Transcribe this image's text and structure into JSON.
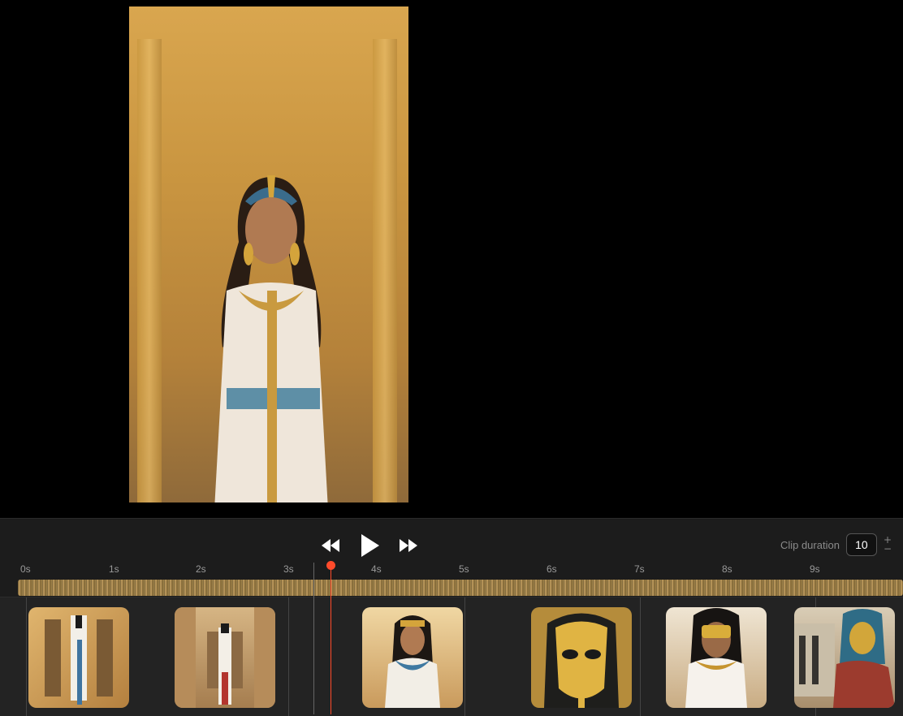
{
  "preview": {
    "image": "egyptian-woman-preview"
  },
  "transport": {
    "rewind_icon": "rewind-icon",
    "play_icon": "play-icon",
    "forward_icon": "fast-forward-icon"
  },
  "clip_duration": {
    "label": "Clip duration",
    "value": "10"
  },
  "ruler": {
    "ticks": [
      "0s",
      "1s",
      "2s",
      "3s",
      "4s",
      "5s",
      "6s",
      "7s",
      "8s",
      "9s"
    ]
  },
  "playhead": {
    "time_seconds": 3.5
  },
  "thumbnails": [
    {
      "name": "pharaoh-guards-clip"
    },
    {
      "name": "temple-queen-clip"
    },
    {
      "name": "cleopatra-portrait-clip"
    },
    {
      "name": "golden-mask-clip"
    },
    {
      "name": "golden-mask-woman-clip"
    },
    {
      "name": "masked-man-temple-clip"
    }
  ],
  "colors": {
    "playhead": "#ff4b2b",
    "panel": "#1c1c1c"
  }
}
